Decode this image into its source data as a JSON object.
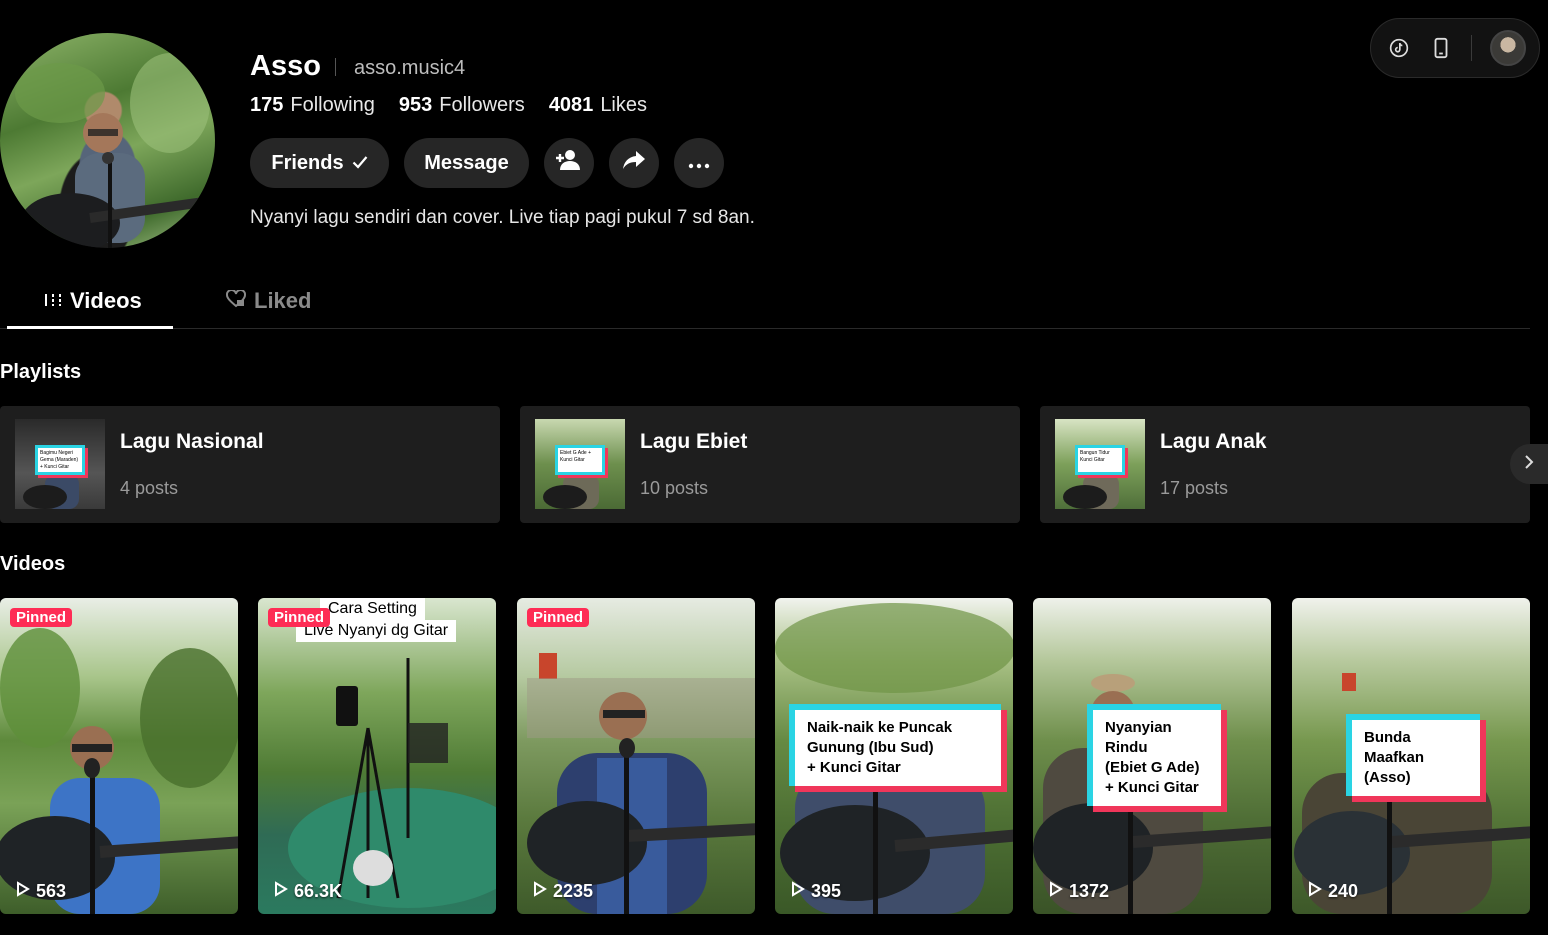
{
  "top_bar": {
    "icons": [
      "tiktok-icon",
      "mobile-icon"
    ],
    "avatar_alt": "user-avatar"
  },
  "profile": {
    "name": "Asso",
    "handle": "asso.music4",
    "stats": [
      {
        "num": "175",
        "label": "Following"
      },
      {
        "num": "953",
        "label": "Followers"
      },
      {
        "num": "4081",
        "label": "Likes"
      }
    ],
    "buttons": {
      "friends": "Friends",
      "message": "Message"
    },
    "bio": "Nyanyi lagu sendiri dan cover. Live tiap pagi pukul 7 sd 8an."
  },
  "tabs": {
    "videos": "Videos",
    "liked": "Liked"
  },
  "sections": {
    "playlists": "Playlists",
    "videos": "Videos"
  },
  "playlists": [
    {
      "name": "Lagu Nasional",
      "count": "4 posts",
      "thumb_text": "Bagimu Negeri Gema (Maraden) + Kunci Gitar"
    },
    {
      "name": "Lagu Ebiet",
      "count": "10 posts",
      "thumb_text": "Ebiet G Ade + Kunci Gitar"
    },
    {
      "name": "Lagu Anak",
      "count": "17 posts",
      "thumb_text": "Bangun Tidur Kunci Gitar"
    }
  ],
  "videos": [
    {
      "pinned": "Pinned",
      "views": "563",
      "caption": "",
      "caption_top": ""
    },
    {
      "pinned": "Pinned",
      "views": "66.3K",
      "caption": "",
      "caption_top": [
        "Cara Setting",
        "Live Nyanyi dg Gitar"
      ]
    },
    {
      "pinned": "Pinned",
      "views": "2235",
      "caption": "",
      "caption_top": ""
    },
    {
      "pinned": "",
      "views": "395",
      "caption": [
        "Naik-naik ke Puncak",
        "Gunung (Ibu Sud)",
        "+ Kunci Gitar"
      ],
      "caption_top": ""
    },
    {
      "pinned": "",
      "views": "1372",
      "caption": [
        "Nyanyian Rindu",
        "(Ebiet G Ade)",
        "+ Kunci Gitar"
      ],
      "caption_top": ""
    },
    {
      "pinned": "",
      "views": "240",
      "caption": [
        "Bunda Maafkan",
        "(Asso)"
      ],
      "caption_top": ""
    }
  ],
  "colors": {
    "background": "#000000",
    "button": "#262626",
    "pinned": "#fe2c55",
    "caption_cyan": "#2ad4e4",
    "caption_red": "#f0365a"
  }
}
